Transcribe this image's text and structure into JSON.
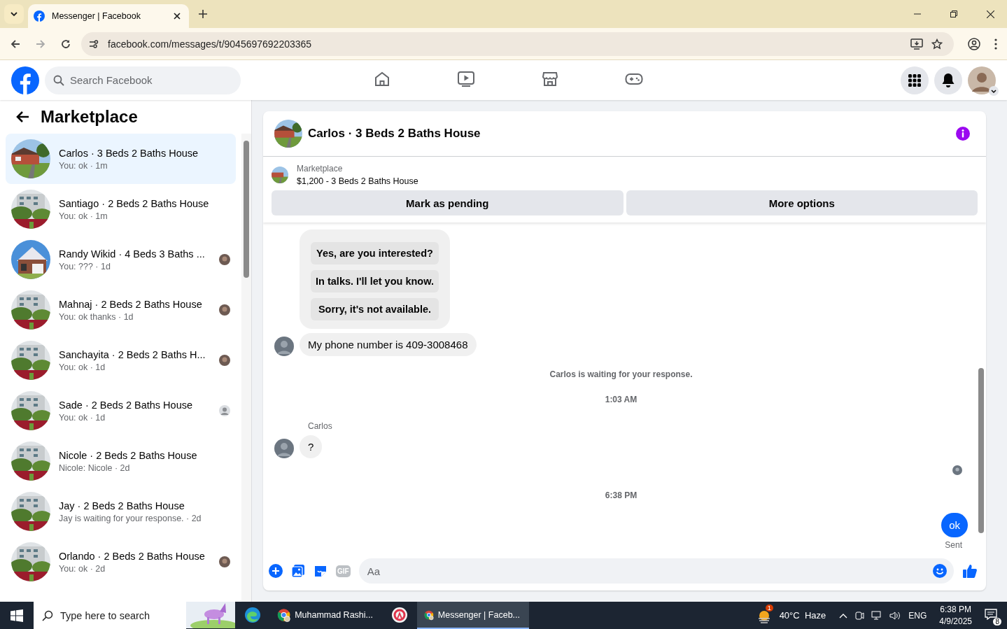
{
  "browser": {
    "tab_title": "Messenger | Facebook",
    "url": "facebook.com/messages/t/9045697692203365",
    "forward_disabled": true
  },
  "header": {
    "search_placeholder": "Search Facebook",
    "nav": [
      {
        "kind": "home",
        "selected": false
      },
      {
        "kind": "video",
        "selected": false
      },
      {
        "kind": "marketplace",
        "selected": false
      },
      {
        "kind": "gaming",
        "selected": false
      }
    ]
  },
  "sidebar": {
    "title": "Marketplace",
    "chats": [
      {
        "name": "Carlos · 3 Beds 2 Baths House",
        "preview": "You: ok · 1m",
        "selected": true
      },
      {
        "name": "Santiago · 2 Beds 2 Baths House",
        "preview": "You: ok · 1m",
        "selected": false
      },
      {
        "name": "Randy Wikid · 4 Beds 3 Baths ...",
        "preview": "You: ??? · 1d",
        "selected": false
      },
      {
        "name": "Mahnaj · 2 Beds 2 Baths House",
        "preview": "You: ok thanks · 1d",
        "selected": false
      },
      {
        "name": "Sanchayita · 2 Beds 2 Baths H...",
        "preview": "You: ok · 1d",
        "selected": false
      },
      {
        "name": "Sade · 2 Beds 2 Baths House",
        "preview": "You: ok · 1d",
        "selected": false,
        "receipt": {
          "kind": "silhouette"
        }
      },
      {
        "name": "Nicole · 2 Beds 2 Baths House",
        "preview": "Nicole: Nicole · 2d",
        "selected": false
      },
      {
        "name": "Jay · 2 Beds 2 Baths House",
        "preview": "Jay is waiting for your response. · 2d",
        "selected": false
      },
      {
        "name": "Orlando · 2 Beds 2 Baths House",
        "preview": "You: ok · 2d",
        "selected": false
      }
    ]
  },
  "chat": {
    "title": "Carlos · 3 Beds 2 Baths House",
    "listing": {
      "source": "Marketplace",
      "summary": "$1,200 - 3 Beds 2 Baths House"
    },
    "actions": [
      "Mark as pending",
      "More options"
    ],
    "messages": [
      {
        "kind": "quick_replies",
        "options": [
          "Yes, are you interested?",
          "In talks. I'll let you know.",
          "Sorry, it's not available."
        ]
      },
      {
        "kind": "incoming",
        "text": "My phone number is 409-3008468",
        "avatar": true
      },
      {
        "kind": "notice",
        "text": "Carlos is waiting for your response."
      },
      {
        "kind": "timestamp",
        "text": "1:03 AM"
      },
      {
        "kind": "sender",
        "text": "Carlos"
      },
      {
        "kind": "incoming",
        "text": "?",
        "avatar": true
      },
      {
        "kind": "read_receipt"
      },
      {
        "kind": "timestamp",
        "text": "6:38 PM"
      },
      {
        "kind": "outgoing",
        "text": "ok",
        "status": "Sent"
      }
    ],
    "composer": {
      "placeholder": "Aa",
      "gif_label": "GIF"
    }
  },
  "taskbar": {
    "search_placeholder": "Type here to search",
    "apps": [
      {
        "kind": "edge",
        "selected": false
      },
      {
        "kind": "chrome",
        "label": "Muhammad Rashi...",
        "selected": false
      },
      {
        "kind": "red",
        "selected": false
      },
      {
        "kind": "chrome",
        "label": "Messenger | Faceb...",
        "selected": true
      }
    ],
    "weather_badge": "1",
    "weather": "40°C  Haze",
    "language": "ENG",
    "time": "6:38 PM",
    "date": "4/9/2025",
    "notifications": "8"
  }
}
